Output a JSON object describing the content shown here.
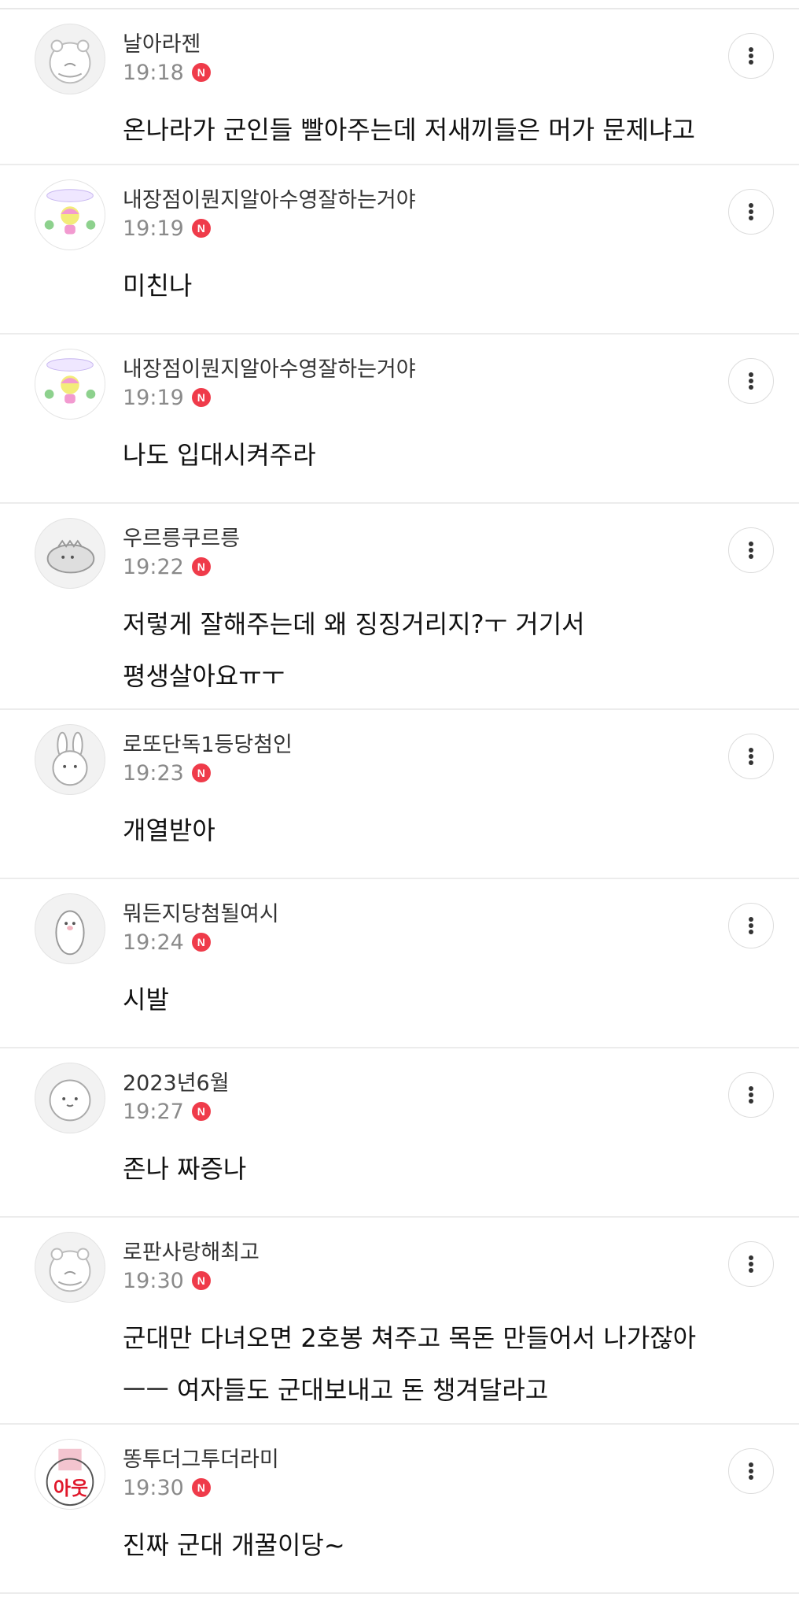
{
  "comments": [
    {
      "username": "날아라젠",
      "time": "19:18",
      "badge": "N",
      "text": "온나라가 군인들 빨아주는데 저새끼들은 머가 문제냐고",
      "avatar": "hamster-avatar"
    },
    {
      "username": "내장점이뭔지알아수영잘하는거야",
      "time": "19:19",
      "badge": "N",
      "text": "미친나",
      "avatar": "pink-character-avatar"
    },
    {
      "username": "내장점이뭔지알아수영잘하는거야",
      "time": "19:19",
      "badge": "N",
      "text": "나도 입대시켜주라",
      "avatar": "pink-character-avatar"
    },
    {
      "username": "우르릉쿠르릉",
      "time": "19:22",
      "badge": "N",
      "text_line1": "저렇게 잘해주는데 왜 징징거리지?ㅜ 거기서",
      "text_line2": "평생살아요ㅠㅜ",
      "avatar": "dinosaur-avatar"
    },
    {
      "username": "로또단독1등당첨인",
      "time": "19:23",
      "badge": "N",
      "text": "개열받아",
      "avatar": "rabbit-avatar"
    },
    {
      "username": "뭐든지당첨될여시",
      "time": "19:24",
      "badge": "N",
      "text": "시발",
      "avatar": "penguin-avatar"
    },
    {
      "username": "2023년6월",
      "time": "19:27",
      "badge": "N",
      "text": "존나 짜증나",
      "avatar": "round-face-avatar"
    },
    {
      "username": "로판사랑해최고",
      "time": "19:30",
      "badge": "N",
      "text_line1": "군대만 다녀오면 2호봉 쳐주고 목돈 만들어서 나가잖아",
      "text_line2": "ㅡㅡ 여자들도 군대보내고 돈 챙겨달라고",
      "avatar": "hamster-avatar"
    },
    {
      "username": "똥투더그투더라미",
      "time": "19:30",
      "badge": "N",
      "text": "진짜 군대 개꿀이당~",
      "avatar": "ayo-text-avatar",
      "avatar_text": "아웃"
    }
  ]
}
